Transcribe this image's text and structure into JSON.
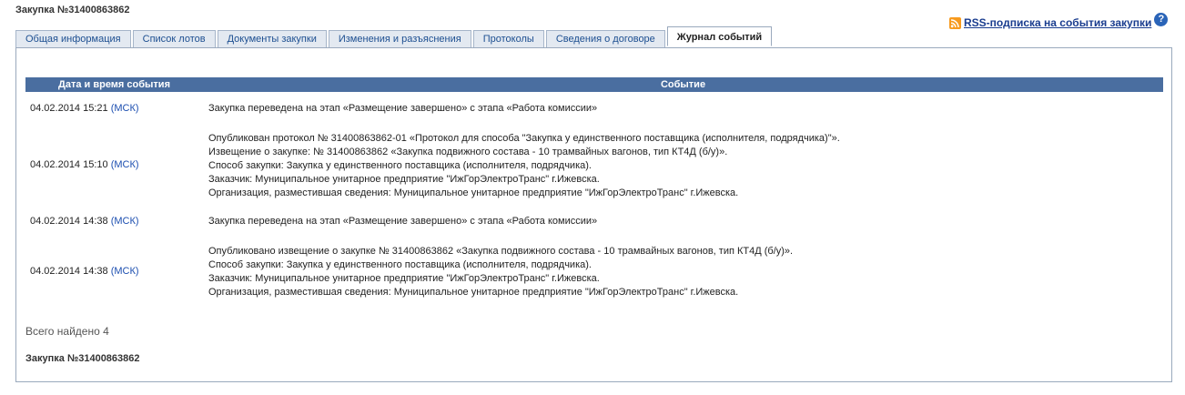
{
  "page_title": "Закупка №31400863862",
  "rss": {
    "label": "RSS-подписка на события закупки",
    "help": "?"
  },
  "tabs": [
    {
      "label": "Общая информация"
    },
    {
      "label": "Список лотов"
    },
    {
      "label": "Документы закупки"
    },
    {
      "label": "Изменения и разъяснения"
    },
    {
      "label": "Протоколы"
    },
    {
      "label": "Сведения о договоре"
    },
    {
      "label": "Журнал событий",
      "active": true
    }
  ],
  "table": {
    "headers": [
      "Дата и время события",
      "Событие"
    ],
    "rows": [
      {
        "date": "04.02.2014 15:21",
        "tz": "(МСК)",
        "lines": [
          "Закупка переведена на этап «Размещение завершено» с этапа «Работа комиссии»"
        ]
      },
      {
        "date": "04.02.2014 15:10",
        "tz": "(МСК)",
        "lines": [
          "Опубликован протокол № 31400863862-01 «Протокол для способа \"Закупка у единственного поставщика (исполнителя, подрядчика)\"».",
          "Извещение о закупке: № 31400863862 «Закупка подвижного состава - 10 трамвайных вагонов, тип КТ4Д (б/у)».",
          "Способ закупки: Закупка у единственного поставщика (исполнителя, подрядчика).",
          "Заказчик: Муниципальное унитарное предприятие \"ИжГорЭлектроТранс\" г.Ижевска.",
          "Организация, разместившая сведения: Муниципальное унитарное предприятие \"ИжГорЭлектроТранс\" г.Ижевска."
        ]
      },
      {
        "date": "04.02.2014 14:38",
        "tz": "(МСК)",
        "lines": [
          "Закупка переведена на этап «Размещение завершено» с этапа «Работа комиссии»"
        ]
      },
      {
        "date": "04.02.2014 14:38",
        "tz": "(МСК)",
        "lines": [
          "Опубликовано извещение о закупке № 31400863862 «Закупка подвижного состава - 10 трамвайных вагонов, тип КТ4Д (б/у)».",
          "Способ закупки: Закупка у единственного поставщика (исполнителя, подрядчика).",
          "Заказчик: Муниципальное унитарное предприятие \"ИжГорЭлектроТранс\" г.Ижевска.",
          "Организация, разместившая сведения: Муниципальное унитарное предприятие \"ИжГорЭлектроТранс\" г.Ижевска."
        ]
      }
    ]
  },
  "found_text": "Всего найдено 4",
  "footer_title": "Закупка №31400863862"
}
